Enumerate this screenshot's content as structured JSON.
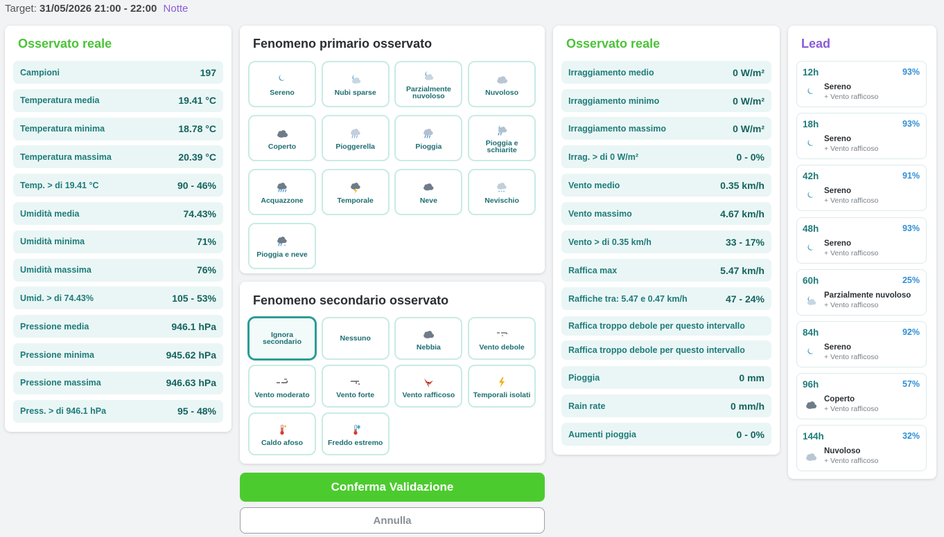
{
  "header": {
    "target_label": "Target:",
    "target_value": "31/05/2026 21:00 - 22:00",
    "period": "Notte"
  },
  "observed_left": {
    "title": "Osservato reale",
    "rows": [
      {
        "label": "Campioni",
        "value": "197"
      },
      {
        "label": "Temperatura media",
        "value": "19.41 °C"
      },
      {
        "label": "Temperatura minima",
        "value": "18.78 °C"
      },
      {
        "label": "Temperatura massima",
        "value": "20.39 °C"
      },
      {
        "label": "Temp. > di 19.41 °C",
        "value": "90 - 46%"
      },
      {
        "label": "Umidità media",
        "value": "74.43%"
      },
      {
        "label": "Umidità minima",
        "value": "71%"
      },
      {
        "label": "Umidità massima",
        "value": "76%"
      },
      {
        "label": "Umid. > di 74.43%",
        "value": "105 - 53%"
      },
      {
        "label": "Pressione media",
        "value": "946.1 hPa"
      },
      {
        "label": "Pressione minima",
        "value": "945.62 hPa"
      },
      {
        "label": "Pressione massima",
        "value": "946.63 hPa"
      },
      {
        "label": "Press. > di 946.1 hPa",
        "value": "95 - 48%"
      }
    ]
  },
  "primary": {
    "title": "Fenomeno primario osservato",
    "tiles": [
      {
        "label": "Sereno",
        "icon": "moon-icon"
      },
      {
        "label": "Nubi sparse",
        "icon": "moon-cloud-icon"
      },
      {
        "label": "Parzialmente nuvoloso",
        "icon": "moon-cloud-icon"
      },
      {
        "label": "Nuvoloso",
        "icon": "cloud-icon"
      },
      {
        "label": "Coperto",
        "icon": "dark-cloud-icon"
      },
      {
        "label": "Pioggerella",
        "icon": "drizzle-icon"
      },
      {
        "label": "Pioggia",
        "icon": "rain-icon"
      },
      {
        "label": "Pioggia e schiarite",
        "icon": "moon-rain-icon"
      },
      {
        "label": "Acquazzone",
        "icon": "heavy-rain-icon"
      },
      {
        "label": "Temporale",
        "icon": "thunderstorm-icon"
      },
      {
        "label": "Neve",
        "icon": "snow-icon"
      },
      {
        "label": "Nevischio",
        "icon": "sleet-icon"
      },
      {
        "label": "Pioggia e neve",
        "icon": "rain-snow-icon"
      }
    ]
  },
  "secondary": {
    "title": "Fenomeno secondario osservato",
    "tiles": [
      {
        "label": "Ignora secondario",
        "icon": ""
      },
      {
        "label": "Nessuno",
        "icon": ""
      },
      {
        "label": "Nebbia",
        "icon": "fog-icon"
      },
      {
        "label": "Vento debole",
        "icon": "wind-weak-icon"
      },
      {
        "label": "Vento moderato",
        "icon": "wind-moderate-icon"
      },
      {
        "label": "Vento forte",
        "icon": "wind-strong-icon"
      },
      {
        "label": "Vento rafficoso",
        "icon": "gust-icon"
      },
      {
        "label": "Temporali isolati",
        "icon": "lightning-icon"
      },
      {
        "label": "Caldo afoso",
        "icon": "thermometer-hot-icon"
      },
      {
        "label": "Freddo estremo",
        "icon": "thermometer-cold-icon"
      }
    ]
  },
  "observed_right": {
    "title": "Osservato reale",
    "rows": [
      {
        "label": "Irraggiamento medio",
        "value": "0 W/m²"
      },
      {
        "label": "Irraggiamento minimo",
        "value": "0 W/m²"
      },
      {
        "label": "Irraggiamento massimo",
        "value": "0 W/m²"
      },
      {
        "label": "Irrag. > di 0 W/m²",
        "value": "0 - 0%"
      },
      {
        "label": "Vento medio",
        "value": "0.35 km/h"
      },
      {
        "label": "Vento massimo",
        "value": "4.67 km/h"
      },
      {
        "label": "Vento > di 0.35 km/h",
        "value": "33 - 17%"
      },
      {
        "label": "Raffica max",
        "value": "5.47 km/h"
      },
      {
        "label": "Raffiche tra: 5.47 e 0.47 km/h",
        "value": "47 - 24%"
      },
      {
        "label": "Raffica troppo debole per questo intervallo",
        "value": ""
      },
      {
        "label": "Raffica troppo debole per questo intervallo",
        "value": ""
      },
      {
        "label": "Pioggia",
        "value": "0 mm"
      },
      {
        "label": "Rain rate",
        "value": "0 mm/h"
      },
      {
        "label": "Aumenti pioggia",
        "value": "0 - 0%"
      }
    ]
  },
  "lead": {
    "title": "Lead",
    "items": [
      {
        "hours": "12h",
        "pct": "93%",
        "name": "Sereno",
        "sub": "+ Vento rafficoso",
        "icon": "moon-icon"
      },
      {
        "hours": "18h",
        "pct": "93%",
        "name": "Sereno",
        "sub": "+ Vento rafficoso",
        "icon": "moon-icon"
      },
      {
        "hours": "42h",
        "pct": "91%",
        "name": "Sereno",
        "sub": "+ Vento rafficoso",
        "icon": "moon-icon"
      },
      {
        "hours": "48h",
        "pct": "93%",
        "name": "Sereno",
        "sub": "+ Vento rafficoso",
        "icon": "moon-icon"
      },
      {
        "hours": "60h",
        "pct": "25%",
        "name": "Parzialmente nuvoloso",
        "sub": "+ Vento rafficoso",
        "icon": "moon-cloud-icon"
      },
      {
        "hours": "84h",
        "pct": "92%",
        "name": "Sereno",
        "sub": "+ Vento rafficoso",
        "icon": "moon-icon"
      },
      {
        "hours": "96h",
        "pct": "57%",
        "name": "Coperto",
        "sub": "+ Vento rafficoso",
        "icon": "dark-cloud-icon"
      },
      {
        "hours": "144h",
        "pct": "32%",
        "name": "Nuvoloso",
        "sub": "+ Vento rafficoso",
        "icon": "cloud-icon"
      }
    ]
  },
  "buttons": {
    "confirm": "Conferma Validazione",
    "cancel": "Annulla"
  }
}
